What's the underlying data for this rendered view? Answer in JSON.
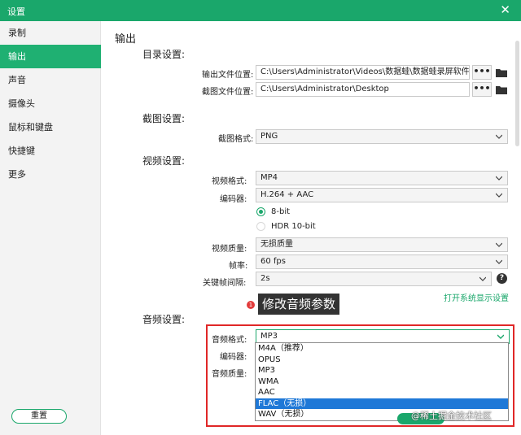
{
  "window": {
    "title": "设置",
    "close_glyph": "✕"
  },
  "sidebar": {
    "items": [
      {
        "label": "录制"
      },
      {
        "label": "输出"
      },
      {
        "label": "声音"
      },
      {
        "label": "摄像头"
      },
      {
        "label": "鼠标和键盘"
      },
      {
        "label": "快捷键"
      },
      {
        "label": "更多"
      }
    ],
    "active": "输出",
    "reset_label": "重置"
  },
  "main": {
    "section_title": "输出",
    "directory": {
      "title": "目录设置:",
      "output_label": "输出文件位置:",
      "output_value": "C:\\Users\\Administrator\\Videos\\数据蛙\\数据蛙录屏软件",
      "screenshot_label": "截图文件位置:",
      "screenshot_value": "C:\\Users\\Administrator\\Desktop",
      "browse_label": "•••"
    },
    "screenshot": {
      "title": "截图设置:",
      "format_label": "截图格式:",
      "format_value": "PNG"
    },
    "video": {
      "title": "视频设置:",
      "format_label": "视频格式:",
      "format_value": "MP4",
      "encoder_label": "编码器:",
      "encoder_value": "H.264 + AAC",
      "bit_8_label": "8-bit",
      "bit_10_label": "HDR 10-bit",
      "quality_label": "视频质量:",
      "quality_value": "无损质量",
      "fps_label": "帧率:",
      "fps_value": "60 fps",
      "keyframe_label": "关键帧间隔:",
      "keyframe_value": "2s",
      "help_glyph": "?",
      "system_link": "打开系统显示设置"
    },
    "annotation": {
      "badge": "1",
      "text": "修改音频参数"
    },
    "audio": {
      "title": "音频设置:",
      "format_label": "音频格式:",
      "format_value": "MP3",
      "encoder_label": "编码器:",
      "quality_label": "音频质量:",
      "options": [
        "M4A（推荐）",
        "OPUS",
        "MP3",
        "WMA",
        "AAC",
        "FLAC（无损）",
        "WAV（无损）"
      ],
      "highlighted_option": "FLAC（无损）"
    }
  },
  "watermark": "@稀土掘金技术社区",
  "colors": {
    "accent": "#1aa76b",
    "highlight": "#1e78d7",
    "annotation_box": "#e02727"
  }
}
